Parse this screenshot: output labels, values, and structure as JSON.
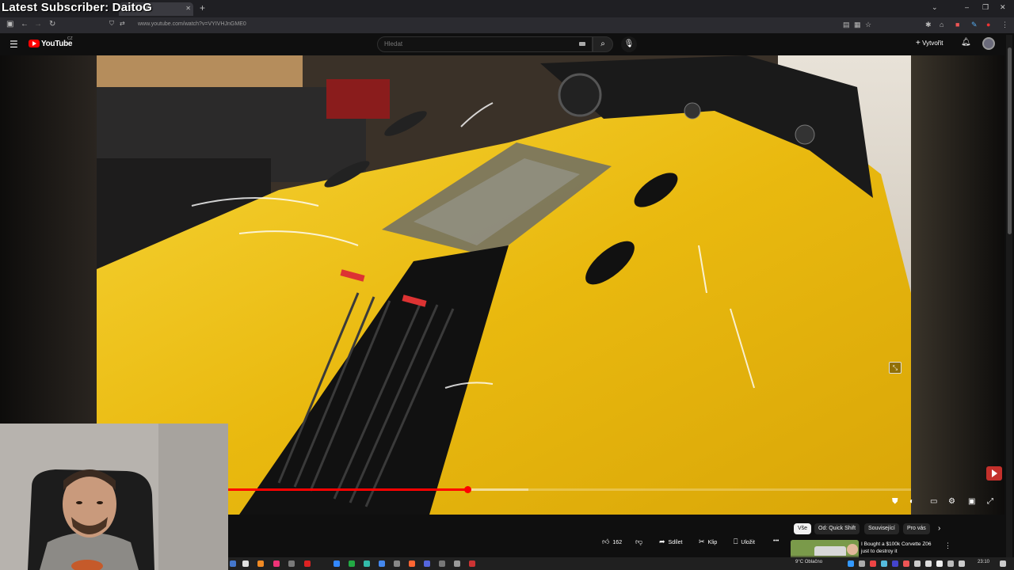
{
  "overlay": {
    "title": "Latest Subscriber: DaitoG"
  },
  "browser": {
    "active_tab_title": "en's Car C",
    "url": "www.youtube.com/watch?v=VYIVHJnGME0"
  },
  "youtube": {
    "logo_text": "YouTube",
    "country_code": "CZ",
    "search_placeholder": "Hledat",
    "create_label": "Vytvořit"
  },
  "player": {
    "progress_played": 0.35,
    "progress_buffered": 0.44
  },
  "actions": {
    "like_count": "162",
    "share_label": "Sdílet",
    "clip_label": "Klip",
    "save_label": "Uložit"
  },
  "chips": [
    {
      "label": "Vše"
    },
    {
      "label": "Od: Quick Shift"
    },
    {
      "label": "Související"
    },
    {
      "label": "Pro vás"
    }
  ],
  "recommendation": {
    "title": "I Bought a $100k Corvette Z06 just to destroy it"
  },
  "taskbar": {
    "weather": "9°C  Oblačno",
    "time": "23:10"
  },
  "icons": {
    "menu": "hamburger-icon",
    "search": "search-icon",
    "mic": "microphone-icon",
    "bell": "bell-icon",
    "like": "thumbs-up-icon",
    "dislike": "thumbs-down-icon",
    "share": "share-icon",
    "clip": "scissors-icon",
    "save": "bookmark-icon",
    "more": "more-icon"
  },
  "colors": {
    "accent": "#ff0000",
    "car_yellow": "#f0c419",
    "background": "#0f0f0f"
  }
}
